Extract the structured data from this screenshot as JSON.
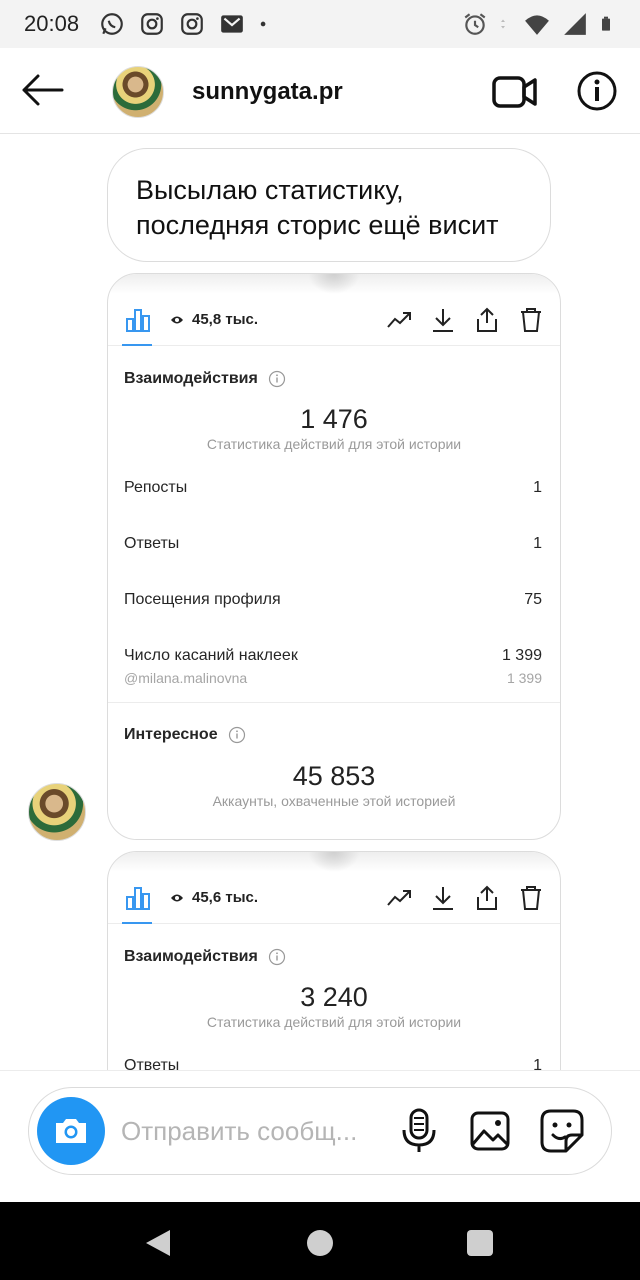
{
  "status_bar": {
    "time": "20:08",
    "left_icons": [
      "whatsapp-icon",
      "instagram-icon",
      "instagram-icon",
      "gmail-icon",
      "dot-icon"
    ],
    "right_icons": [
      "alarm-icon",
      "data-arrows-icon",
      "wifi-icon",
      "signal-icon",
      "battery-icon"
    ]
  },
  "header": {
    "username": "sunnygata.pr"
  },
  "chat": {
    "text_message": "Высылаю статистику, последняя сторис ещё висит",
    "cards": [
      {
        "views": "45,8 тыс.",
        "interactions_title": "Взаимодействия",
        "interactions_total": "1 476",
        "interactions_caption": "Статистика действий для этой истории",
        "rows": [
          {
            "label": "Репосты",
            "value": "1"
          },
          {
            "label": "Ответы",
            "value": "1"
          },
          {
            "label": "Посещения профиля",
            "value": "75"
          },
          {
            "label": "Число касаний наклеек",
            "value": "1 399"
          }
        ],
        "sticker_sub": {
          "label": "@milana.malinovna",
          "value": "1 399"
        },
        "discovery_title": "Интересное",
        "discovery_total": "45 853",
        "discovery_caption": "Аккаунты, охваченные этой историей"
      },
      {
        "views": "45,6 тыс.",
        "interactions_title": "Взаимодействия",
        "interactions_total": "3 240",
        "interactions_caption": "Статистика действий для этой истории",
        "rows": [
          {
            "label": "Ответы",
            "value": "1"
          }
        ]
      }
    ]
  },
  "composer": {
    "placeholder": "Отправить сообщ..."
  },
  "colors": {
    "accent": "#2196f3",
    "insights_blue": "#3897f0"
  }
}
